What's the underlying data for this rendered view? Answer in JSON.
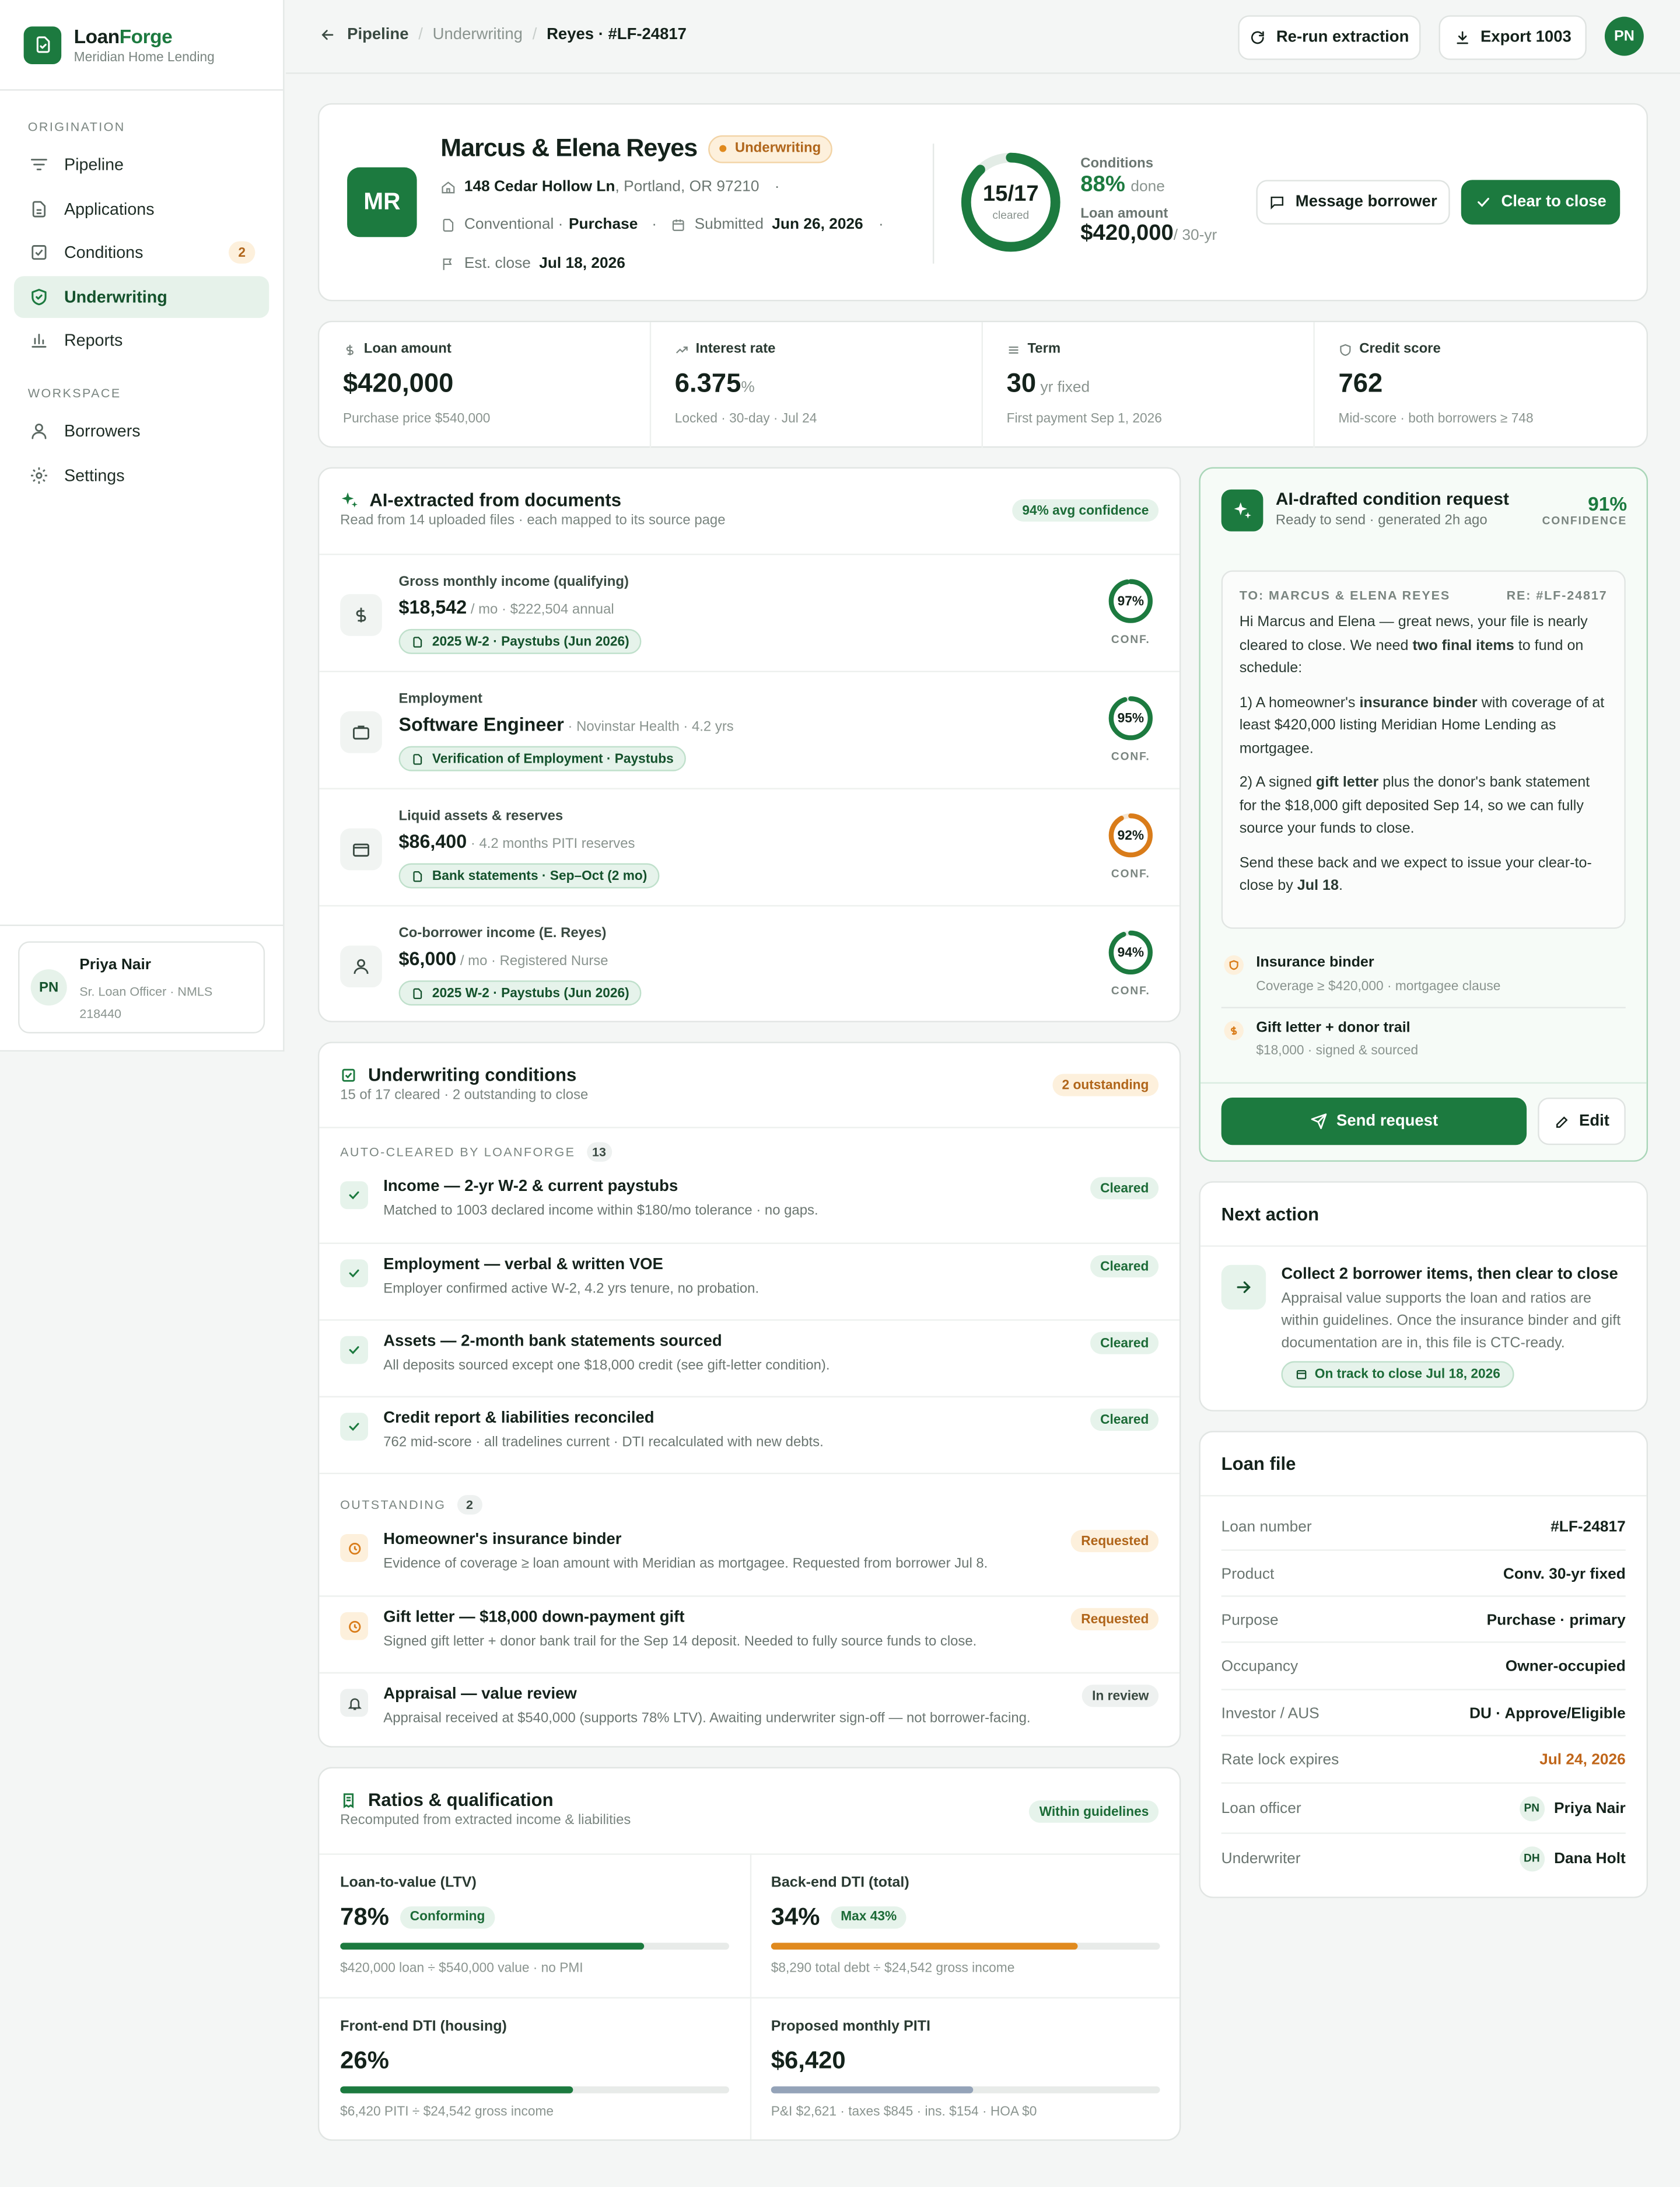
{
  "app": {
    "name_a": "Loan",
    "name_b": "Forge",
    "org": "Meridian Home Lending"
  },
  "sidebar": {
    "section_origination": "Origination",
    "section_workspace": "Workspace",
    "items": [
      {
        "label": "Pipeline",
        "icon": "filter-lines-icon"
      },
      {
        "label": "Applications",
        "icon": "document-icon"
      },
      {
        "label": "Conditions",
        "icon": "checklist-icon",
        "badge": "2"
      },
      {
        "label": "Underwriting",
        "icon": "shield-check-icon",
        "active": true
      },
      {
        "label": "Reports",
        "icon": "bar-chart-icon"
      },
      {
        "label": "Borrowers",
        "icon": "users-icon"
      },
      {
        "label": "Settings",
        "icon": "gear-icon"
      }
    ],
    "user": {
      "initials": "PN",
      "name": "Priya Nair",
      "role": "Sr. Loan Officer · NMLS 218440"
    }
  },
  "topbar": {
    "crumbs": [
      "Pipeline",
      "Underwriting",
      "Reyes · #LF-24817"
    ],
    "rerun_label": "Re-run extraction",
    "export_label": "Export 1003",
    "user_initials": "PN"
  },
  "borrower": {
    "initials": "MR",
    "name": "Marcus & Elena Reyes",
    "status": "Underwriting",
    "address": "148 Cedar Hollow Ln",
    "city": ", Portland, OR 97210",
    "loan_type": "Conventional ·",
    "purpose": "Purchase",
    "submitted_label": "Submitted",
    "submitted_date": "Jun 26, 2026",
    "close_label": "Est. close",
    "close_date": "Jul 18, 2026",
    "progress_text": "15/17",
    "progress_sub": "cleared",
    "progress_fraction": 0.88,
    "conditions_label": "Conditions",
    "conditions_pct": "88%",
    "conditions_done": "done",
    "loan_amount_label": "Loan amount",
    "loan_amount": "$420,000",
    "loan_term": "/ 30-yr",
    "message_label": "Message borrower",
    "clear_label": "Clear to close"
  },
  "stats": [
    {
      "label": "Loan amount",
      "value": "$420,000",
      "unit": "",
      "sub": "Purchase price $540,000",
      "icon": "dollar-icon"
    },
    {
      "label": "Interest rate",
      "value": "6.375",
      "unit": "%",
      "sub": "Locked · 30-day · Jul 24",
      "icon": "trend-up-icon"
    },
    {
      "label": "Term",
      "value": "30",
      "unit": " yr fixed",
      "sub": "First payment Sep 1, 2026",
      "icon": "lines-icon"
    },
    {
      "label": "Credit score",
      "value": "762",
      "unit": "",
      "sub": "Mid-score · both borrowers ≥ 748",
      "icon": "shield-icon"
    }
  ],
  "extracted": {
    "title": "AI-extracted from documents",
    "subtitle": "Read from 14 uploaded files · each mapped to its source page",
    "badge": "94% avg confidence",
    "conf_label": "CONF.",
    "rows": [
      {
        "label": "Gross monthly income (qualifying)",
        "value": "$18,542",
        "detail": " / mo · $222,504 annual",
        "source": "2025 W-2 · Paystubs (Jun 2026)",
        "conf": "97%",
        "conf_value": 0.97,
        "color": "#1c7a3f",
        "icon": "dollar-icon"
      },
      {
        "label": "Employment",
        "value": "Software Engineer",
        "detail": " · Novinstar Health · 4.2 yrs",
        "source": "Verification of Employment · Paystubs",
        "conf": "95%",
        "conf_value": 0.95,
        "color": "#1c7a3f",
        "icon": "briefcase-icon"
      },
      {
        "label": "Liquid assets & reserves",
        "value": "$86,400",
        "detail": " · 4.2 months PITI reserves",
        "source": "Bank statements · Sep–Oct (2 mo)",
        "conf": "92%",
        "conf_value": 0.92,
        "color": "#d97c1a",
        "icon": "wallet-icon"
      },
      {
        "label": "Co-borrower income (E. Reyes)",
        "value": "$6,000",
        "detail": " / mo · Registered Nurse",
        "source": "2025 W-2 · Paystubs (Jun 2026)",
        "conf": "94%",
        "conf_value": 0.94,
        "color": "#1c7a3f",
        "icon": "user-icon"
      }
    ]
  },
  "conditions": {
    "title": "Underwriting conditions",
    "subtitle": "15 of 17 cleared · 2 outstanding to close",
    "badge": "2 outstanding",
    "auto_label": "AUTO-CLEARED BY LOANFORGE",
    "auto_count": "13",
    "out_label": "OUTSTANDING",
    "out_count": "2",
    "cleared": [
      {
        "title": "Income — 2-yr W-2 & current paystubs",
        "desc": "Matched to 1003 declared income within $180/mo tolerance · no gaps.",
        "tag": "Cleared"
      },
      {
        "title": "Employment — verbal & written VOE",
        "desc": "Employer confirmed active W-2, 4.2 yrs tenure, no probation.",
        "tag": "Cleared"
      },
      {
        "title": "Assets — 2-month bank statements sourced",
        "desc": "All deposits sourced except one $18,000 credit (see gift-letter condition).",
        "tag": "Cleared"
      },
      {
        "title": "Credit report & liabilities reconciled",
        "desc": "762 mid-score · all tradelines current · DTI recalculated with new debts.",
        "tag": "Cleared"
      }
    ],
    "outstanding": [
      {
        "title": "Homeowner's insurance binder",
        "desc": "Evidence of coverage ≥ loan amount with Meridian as mortgagee. Requested from borrower Jul 8.",
        "tag": "Requested",
        "kind": "clock"
      },
      {
        "title": "Gift letter — $18,000 down-payment gift",
        "desc": "Signed gift letter + donor bank trail for the Sep 14 deposit. Needed to fully source funds to close.",
        "tag": "Requested",
        "kind": "clock"
      },
      {
        "title": "Appraisal — value review",
        "desc": "Appraisal received at $540,000 (supports 78% LTV). Awaiting underwriter sign-off — not borrower-facing.",
        "tag": "In review",
        "kind": "bell"
      }
    ]
  },
  "ratios": {
    "title": "Ratios & qualification",
    "subtitle": "Recomputed from extracted income & liabilities",
    "badge": "Within guidelines",
    "items": [
      {
        "label": "Loan-to-value (LTV)",
        "value": "78%",
        "pill": "Conforming",
        "fill": 0.78,
        "color": "#1c7a3f",
        "sub": "$420,000 loan ÷ $540,000 value · no PMI"
      },
      {
        "label": "Back-end DTI (total)",
        "value": "34%",
        "pill": "Max 43%",
        "fill": 0.79,
        "color": "#e08a1e",
        "sub": "$8,290 total debt ÷ $24,542 gross income"
      },
      {
        "label": "Front-end DTI (housing)",
        "value": "26%",
        "pill": "",
        "fill": 0.6,
        "color": "#1c7a3f",
        "sub": "$6,420 PITI ÷ $24,542 gross income"
      },
      {
        "label": "Proposed monthly PITI",
        "value": "$6,420",
        "pill": "",
        "fill": 0.52,
        "color": "#94a3b8",
        "sub": "P&I $2,621 · taxes $845 · ins. $154 · HOA $0"
      }
    ]
  },
  "ai_request": {
    "title": "AI-drafted condition request",
    "subtitle": "Ready to send · generated 2h ago",
    "confidence": "91%",
    "confidence_label": "CONFIDENCE",
    "to": "TO: MARCUS & ELENA REYES",
    "re": "RE: #LF-24817",
    "p1_a": "Hi Marcus and Elena — great news, your file is nearly cleared to close. We need ",
    "p1_b": "two final items",
    "p1_c": " to fund on schedule:",
    "p2_a": "1) A homeowner's ",
    "p2_b": "insurance binder",
    "p2_c": " with coverage of at least $420,000 listing Meridian Home Lending as mortgagee.",
    "p3_a": "2) A signed ",
    "p3_b": "gift letter",
    "p3_c": " plus the donor's bank statement for the $18,000 gift deposited Sep 14, so we can fully source your funds to close.",
    "p4_a": "Send these back and we expect to issue your clear-to-close by ",
    "p4_b": "Jul 18",
    "p4_c": ".",
    "items": [
      {
        "title": "Insurance binder",
        "sub": "Coverage ≥ $420,000 · mortgagee clause",
        "icon": "shield-icon"
      },
      {
        "title": "Gift letter + donor trail",
        "sub": "$18,000 · signed & sourced",
        "icon": "dollar-icon"
      }
    ],
    "send_label": "Send request",
    "edit_label": "Edit"
  },
  "next_action": {
    "title": "Next action",
    "heading": "Collect 2 borrower items, then clear to close",
    "body": "Appraisal value supports the loan and ratios are within guidelines. Once the insurance binder and gift documentation are in, this file is CTC-ready.",
    "badge": "On track to close Jul 18, 2026"
  },
  "loan_file": {
    "title": "Loan file",
    "rows": [
      {
        "k": "Loan number",
        "v": "#LF-24817"
      },
      {
        "k": "Product",
        "v": "Conv. 30-yr fixed"
      },
      {
        "k": "Purpose",
        "v": "Purchase · primary"
      },
      {
        "k": "Occupancy",
        "v": "Owner-occupied"
      },
      {
        "k": "Investor / AUS",
        "v": "DU · Approve/Eligible"
      },
      {
        "k": "Rate lock expires",
        "v": "Jul 24, 2026"
      },
      {
        "k": "Loan officer",
        "v": "Priya Nair",
        "initials": "PN"
      },
      {
        "k": "Underwriter",
        "v": "Dana Holt",
        "initials": "DH"
      }
    ],
    "warn_color": "#c0661a"
  }
}
